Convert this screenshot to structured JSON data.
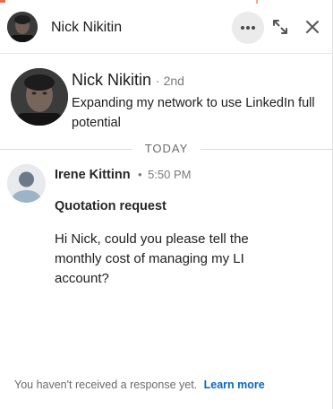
{
  "header": {
    "name": "Nick Nikitin",
    "more_icon": "more-horizontal-icon",
    "expand_icon": "expand-icon",
    "close_icon": "close-icon"
  },
  "profile": {
    "name": "Nick Nikitin",
    "degree": "· 2nd",
    "headline": "Expanding my network to use LinkedIn full potential"
  },
  "divider": {
    "label": "TODAY"
  },
  "message": {
    "sender": "Irene Kittinn",
    "separator": "•",
    "time": "5:50 PM",
    "subject": "Quotation request",
    "body": "Hi Nick, could you please tell the monthly cost of managing my LI account?"
  },
  "footer": {
    "notice": "You haven't received a response yet.",
    "link": "Learn more"
  },
  "colors": {
    "link": "#0a66c2",
    "accent": "#e86a4a",
    "button_bg": "#ebebeb"
  }
}
